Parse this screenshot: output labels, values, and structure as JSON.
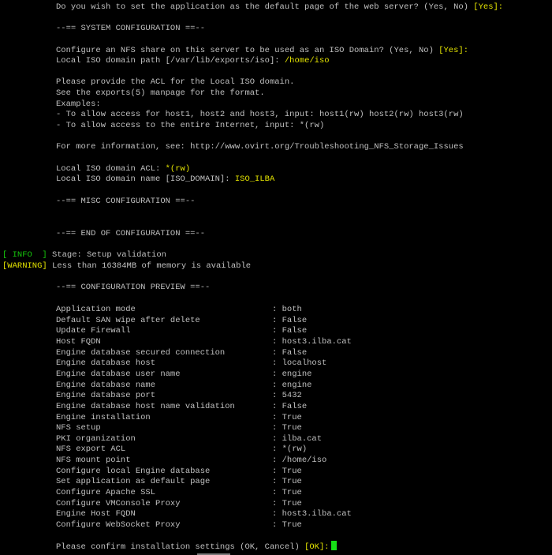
{
  "top_question": {
    "text": "Do you wish to set the application as the default page of the web server? (Yes, No) ",
    "default": "[Yes]:"
  },
  "system_config": {
    "header": "--== SYSTEM CONFIGURATION ==--",
    "nfs_question": "Configure an NFS share on this server to be used as an ISO Domain? (Yes, No) ",
    "nfs_default": "[Yes]:",
    "iso_path_prompt": "Local ISO domain path [/var/lib/exports/iso]: ",
    "iso_path_value": "/home/iso",
    "acl_help": [
      "Please provide the ACL for the Local ISO domain.",
      "See the exports(5) manpage for the format.",
      "Examples:",
      "- To allow access for host1, host2 and host3, input: host1(rw) host2(rw) host3(rw)",
      "- To allow access to the entire Internet, input: *(rw)"
    ],
    "more_info": "For more information, see: http://www.ovirt.org/Troubleshooting_NFS_Storage_Issues",
    "acl_prompt": "Local ISO domain ACL: ",
    "acl_value": "*(rw)",
    "name_prompt": "Local ISO domain name [ISO_DOMAIN]: ",
    "name_value": "ISO_ILBA"
  },
  "misc_header": "--== MISC CONFIGURATION ==--",
  "end_header": "--== END OF CONFIGURATION ==--",
  "status": [
    {
      "tag": "[ INFO  ]",
      "text": " Stage: Setup validation",
      "color": "#16c60c"
    },
    {
      "tag": "[WARNING]",
      "text": " Less than 16384MB of memory is available",
      "color": "#e4e400"
    }
  ],
  "preview_header": "--== CONFIGURATION PREVIEW ==--",
  "preview": [
    {
      "key": "Application mode",
      "value": "both"
    },
    {
      "key": "Default SAN wipe after delete",
      "value": "False"
    },
    {
      "key": "Update Firewall",
      "value": "False"
    },
    {
      "key": "Host FQDN",
      "value": "host3.ilba.cat"
    },
    {
      "key": "Engine database secured connection",
      "value": "False"
    },
    {
      "key": "Engine database host",
      "value": "localhost"
    },
    {
      "key": "Engine database user name",
      "value": "engine"
    },
    {
      "key": "Engine database name",
      "value": "engine"
    },
    {
      "key": "Engine database port",
      "value": "5432"
    },
    {
      "key": "Engine database host name validation",
      "value": "False"
    },
    {
      "key": "Engine installation",
      "value": "True"
    },
    {
      "key": "NFS setup",
      "value": "True"
    },
    {
      "key": "PKI organization",
      "value": "ilba.cat"
    },
    {
      "key": "NFS export ACL",
      "value": "*(rw)"
    },
    {
      "key": "NFS mount point",
      "value": "/home/iso"
    },
    {
      "key": "Configure local Engine database",
      "value": "True"
    },
    {
      "key": "Set application as default page",
      "value": "True"
    },
    {
      "key": "Configure Apache SSL",
      "value": "True"
    },
    {
      "key": "Configure VMConsole Proxy",
      "value": "True"
    },
    {
      "key": "Engine Host FQDN",
      "value": "host3.ilba.cat"
    },
    {
      "key": "Configure WebSocket Proxy",
      "value": "True"
    }
  ],
  "confirm": {
    "prompt": "Please confirm installation settings (OK, Cancel) ",
    "default": "[OK]:"
  },
  "colors": {
    "background": "#000000",
    "text": "#c0c0c0",
    "highlight": "#e4e400",
    "info": "#16c60c",
    "cursor": "#16e016"
  }
}
